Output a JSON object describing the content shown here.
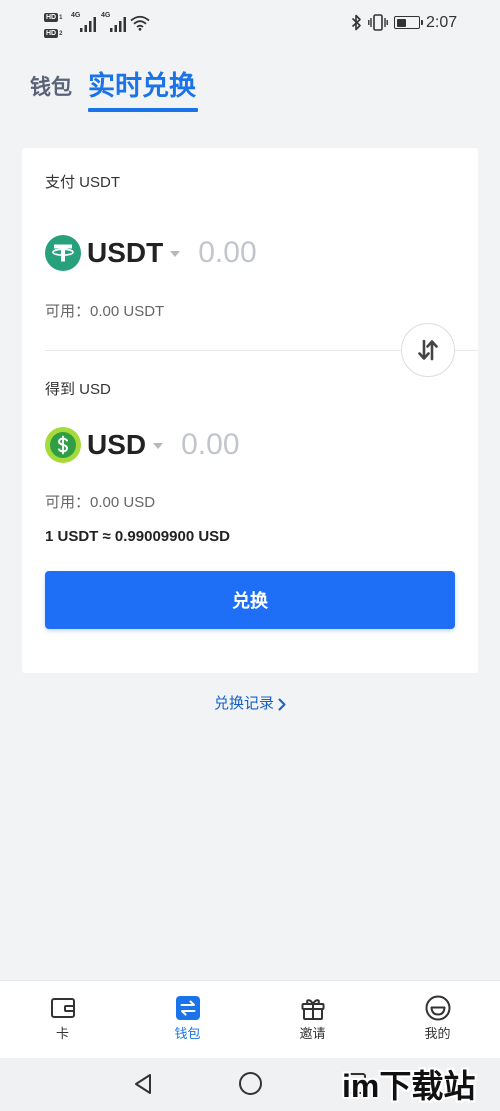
{
  "status_bar": {
    "sim_badges": [
      {
        "label": "HD",
        "slot": "1"
      },
      {
        "label": "HD",
        "slot": "2"
      }
    ],
    "networks": [
      {
        "label": "4G",
        "icon": "signal-icon"
      },
      {
        "label": "4G",
        "icon": "signal-icon"
      }
    ],
    "wifi_icon": "wifi-icon",
    "bluetooth_icon": "bluetooth-icon",
    "vibrate_icon": "vibrate-icon",
    "battery_level": 0.45,
    "time": "2:07"
  },
  "tabs": [
    {
      "label": "钱包",
      "active": false
    },
    {
      "label": "实时兑换",
      "active": true
    }
  ],
  "exchange": {
    "pay": {
      "label": "支付 USDT",
      "currency": "USDT",
      "icon": "tether-icon",
      "amount_placeholder": "0.00",
      "available": "可用：0.00 USDT"
    },
    "swap_icon": "swap-arrows-icon",
    "receive": {
      "label": "得到 USD",
      "currency": "USD",
      "icon": "usd-coin-icon",
      "amount_placeholder": "0.00",
      "available": "可用：0.00 USD"
    },
    "rate": "1 USDT ≈ 0.99009900 USD",
    "submit_label": "兑换"
  },
  "history_link": {
    "label": "兑换记录",
    "icon": "chevron-right-icon"
  },
  "bottom_nav": [
    {
      "label": "卡",
      "icon": "card-icon",
      "active": false
    },
    {
      "label": "钱包",
      "icon": "wallet-exchange-icon",
      "active": true
    },
    {
      "label": "邀请",
      "icon": "gift-icon",
      "active": false
    },
    {
      "label": "我的",
      "icon": "smiley-icon",
      "active": false
    }
  ],
  "system_nav": {
    "back_icon": "back-triangle-icon",
    "home_icon": "home-circle-icon",
    "recents_icon": "recents-square-icon"
  },
  "colors": {
    "accent": "#1a73e8",
    "button": "#1e6ff5",
    "tether": "#26a17b",
    "usd_ring": "#a6d93a",
    "usd_inner": "#2f9e44",
    "placeholder": "#c2c6cc",
    "page_bg": "#f2f3f5"
  },
  "watermark": "im下载站"
}
